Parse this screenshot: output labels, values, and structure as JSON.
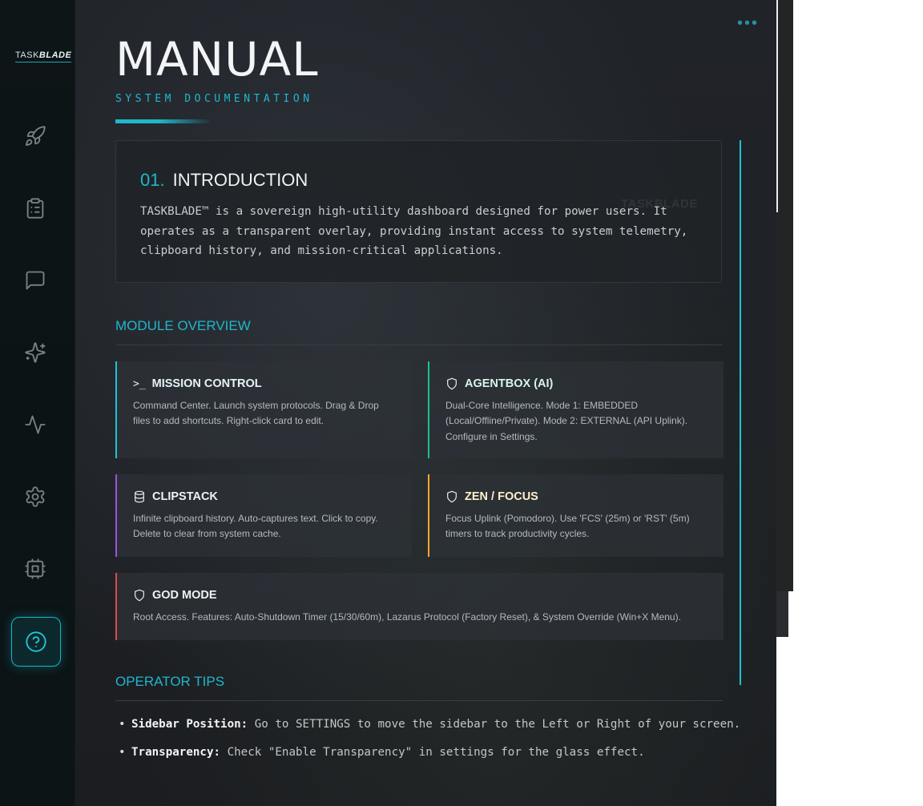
{
  "app": {
    "logo_prefix": "TASK",
    "logo_suffix": "BLADE"
  },
  "sidebar": {
    "items": [
      {
        "icon": "rocket-icon"
      },
      {
        "icon": "clipboard-icon"
      },
      {
        "icon": "chat-icon"
      },
      {
        "icon": "sparkles-icon"
      },
      {
        "icon": "activity-icon"
      },
      {
        "icon": "gear-icon"
      },
      {
        "icon": "cpu-icon"
      },
      {
        "icon": "help-icon",
        "active": true
      }
    ]
  },
  "header": {
    "title": "MANUAL",
    "subtitle": "SYSTEM DOCUMENTATION",
    "more_label": "•••"
  },
  "intro": {
    "number": "01.",
    "title": "INTRODUCTION",
    "watermark": "TASKBLADE",
    "text": "TASKBLADE™ is a sovereign high-utility dashboard designed for power users. It operates as a transparent overlay, providing instant access to system telemetry, clipboard history, and mission-critical applications."
  },
  "modules_section": {
    "heading": "MODULE OVERVIEW",
    "modules": [
      {
        "key": "mission_control",
        "icon": "terminal-icon",
        "title": "MISSION CONTROL",
        "desc": "Command Center. Launch system protocols. Drag & Drop files to add shortcuts. Right-click card to edit.",
        "accent": "#1fc1d6"
      },
      {
        "key": "agentbox",
        "icon": "shield-icon",
        "title": "AGENTBOX (AI)",
        "desc": "Dual-Core Intelligence. Mode 1: EMBEDDED (Local/Offline/Private). Mode 2: EXTERNAL (API Uplink). Configure in Settings.",
        "accent": "#1cc08e"
      },
      {
        "key": "clipstack",
        "icon": "database-icon",
        "title": "CLIPSTACK",
        "desc": "Infinite clipboard history. Auto-captures text. Click to copy. Delete to clear from system cache.",
        "accent": "#9b53e0"
      },
      {
        "key": "zen_focus",
        "icon": "shield-icon",
        "title": "ZEN / FOCUS",
        "desc": "Focus Uplink (Pomodoro). Use 'FCS' (25m) or 'RST' (5m) timers to track productivity cycles.",
        "accent": "#f0a92a"
      },
      {
        "key": "god_mode",
        "icon": "shield-icon",
        "title": "GOD MODE",
        "desc": "Root Access. Features: Auto-Shutdown Timer (15/30/60m), Lazarus Protocol (Factory Reset), & System Override (Win+X Menu).",
        "accent": "#e0484f"
      }
    ]
  },
  "tips_section": {
    "heading": "OPERATOR TIPS",
    "tips": [
      {
        "label": "Sidebar Position:",
        "text": " Go to SETTINGS to move the sidebar to the Left or Right of your screen."
      },
      {
        "label": "Transparency:",
        "text": " Check \"Enable Transparency\" in settings for the glass effect."
      }
    ]
  }
}
